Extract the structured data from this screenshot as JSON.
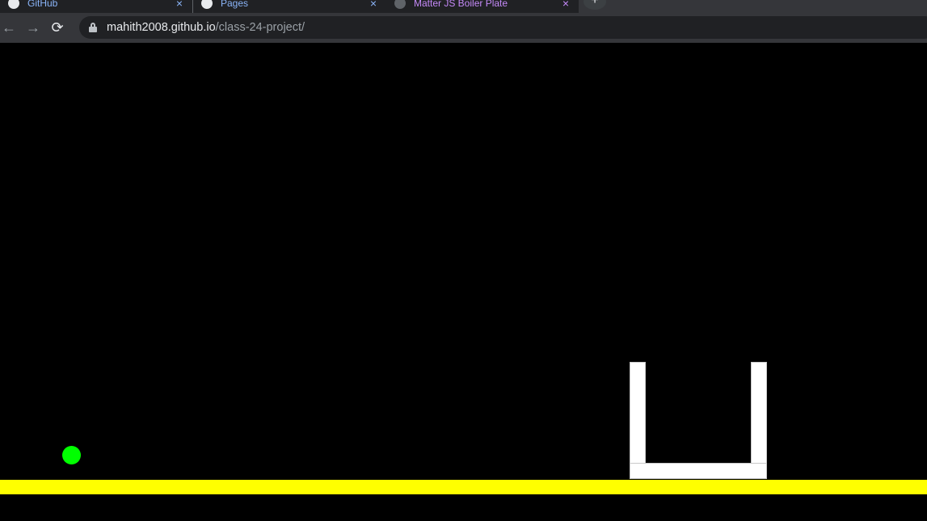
{
  "browser": {
    "tabs": [
      {
        "title": "GitHub",
        "active": false
      },
      {
        "title": "Pages",
        "active": false
      },
      {
        "title": "Matter JS Boiler Plate",
        "active": true
      }
    ],
    "tab_close_glyph": "×",
    "new_tab_glyph": "+",
    "toolbar": {
      "back_glyph": "←",
      "forward_glyph": "→",
      "reload_glyph": "⟳"
    },
    "address": {
      "host": "mahith2008.github.io",
      "path": "/class-24-project/"
    }
  },
  "game": {
    "background_color": "#000000",
    "ground_color": "#ffff00",
    "ball_color": "#00ff00",
    "bin_color": "#ffffff"
  },
  "icons": {
    "tab_1": "github-icon",
    "tab_2": "github-icon",
    "tab_3": "globe-icon",
    "lock": "lock-icon"
  }
}
